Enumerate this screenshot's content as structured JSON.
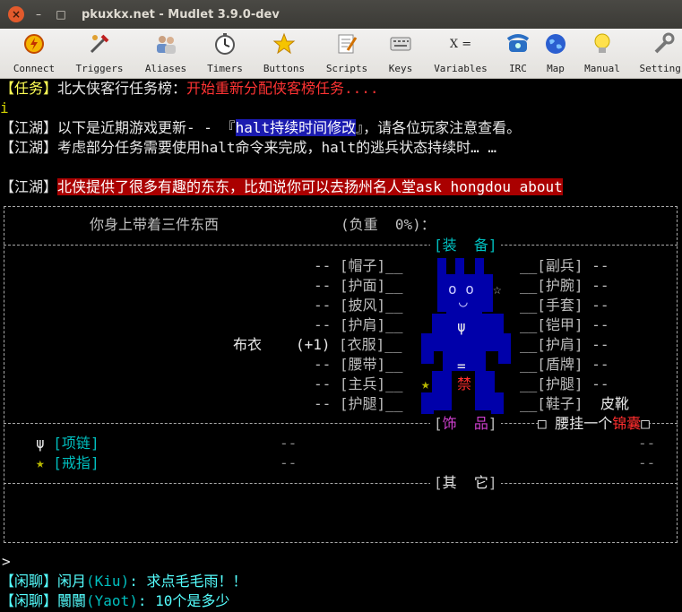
{
  "window": {
    "title": "pkuxkx.net - Mudlet 3.9.0-dev",
    "close_glyph": "×",
    "min_glyph": "–",
    "max_glyph": "□"
  },
  "toolbar": [
    {
      "label": "Connect",
      "icon": "connect-icon"
    },
    {
      "label": "Triggers",
      "icon": "triggers-icon"
    },
    {
      "label": "Aliases",
      "icon": "aliases-icon"
    },
    {
      "label": "Timers",
      "icon": "timers-icon"
    },
    {
      "label": "Buttons",
      "icon": "buttons-icon"
    },
    {
      "label": "Scripts",
      "icon": "scripts-icon"
    },
    {
      "label": "Keys",
      "icon": "keys-icon"
    },
    {
      "label": "Variables",
      "icon": "variables-icon",
      "glyph": "X ="
    },
    {
      "label": "IRC",
      "icon": "irc-icon"
    },
    {
      "label": "Map",
      "icon": "map-icon"
    },
    {
      "label": "Manual",
      "icon": "manual-icon"
    },
    {
      "label": "Settings",
      "icon": "settings-icon"
    }
  ],
  "terminal": {
    "line1": {
      "tag": "【任务】",
      "a": "北大侠客行任务榜：",
      "b": "开始重新分配侠客榜任务...."
    },
    "line2": "i",
    "line3": {
      "tag": "【江湖】",
      "a": "以下是近期游戏更新- - 『",
      "hl": "halt持续时间修改",
      "b": "』，请各位玩家注意查看。"
    },
    "line4": {
      "tag": "【江湖】",
      "a": "考虑部分任务需要使用halt命令来完成，halt的逃兵状态持续时… …"
    },
    "line5": {
      "tag": "【江湖】",
      "a": "北侠提供了很多有趣的东东，比如说你可以去扬州名人堂ask hongdou about"
    },
    "inventory": {
      "header": "你身上带着三件东西",
      "weight": "(负重  0%)：",
      "equip_title": "装  备",
      "accessory_title": "饰  品",
      "other_title": "其  它",
      "left_slots": [
        "帽子",
        "护面",
        "披风",
        "护肩",
        "衣服",
        "腰带",
        "主兵",
        "护腿"
      ],
      "right_slots": [
        "副兵",
        "护腕",
        "手套",
        "铠甲",
        "护肩",
        "盾牌",
        "护腿",
        "鞋子"
      ],
      "cloth_item": "布衣",
      "cloth_bonus": "(+1)",
      "boots_item": "皮靴",
      "face_glyph": "o o",
      "mouth_glyph": "◡",
      "psi_glyph": "ψ",
      "eq_glyph": "=",
      "ban_glyph": "禁",
      "star_glyph": "☆",
      "star_filled": "★",
      "dashes": "--",
      "slot_lead": "-- [",
      "slot_tail": "]__",
      "slot_lead_r": "__[",
      "slot_tail_r": "] --",
      "waist_text": "□ 腰挂一个",
      "waist_item": "锦囊",
      "waist_end": "□",
      "necklace": "项链",
      "ring": "戒指"
    },
    "prompt": ">",
    "chat1": {
      "tag": "【闲聊】",
      "name": "闲月",
      "id": "(Kiu)",
      "msg": ": 求点毛毛雨！！"
    },
    "chat2": {
      "tag": "【闲聊】",
      "name": "闤闤",
      "id": "(Yaot)",
      "msg": ": 10个是多少"
    }
  }
}
